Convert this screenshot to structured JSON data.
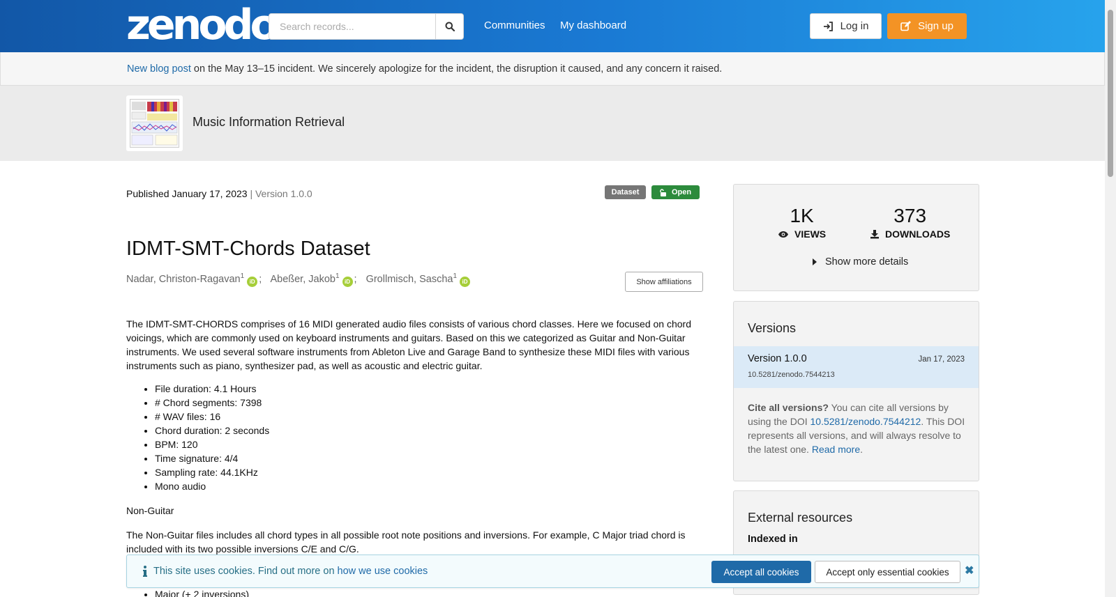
{
  "header": {
    "logo_text": "zenodo",
    "search_placeholder": "Search records...",
    "nav": [
      "Communities",
      "My dashboard"
    ],
    "login_label": "Log in",
    "signup_label": "Sign up"
  },
  "announcement": {
    "link_text": "New blog post",
    "text": " on the May 13–15 incident. We sincerely apologize for the incident, the disruption it caused, and any concern it raised."
  },
  "community": {
    "title": "Music Information Retrieval"
  },
  "record": {
    "published": "Published January 17, 2023",
    "version_text": " | Version 1.0.0",
    "labels": {
      "type": "Dataset",
      "access": "Open"
    },
    "title": "IDMT-SMT-Chords Dataset",
    "authors": [
      {
        "name": "Nadar, Christon-Ragavan",
        "sup": "1"
      },
      {
        "name": "Abeßer, Jakob",
        "sup": "1"
      },
      {
        "name": "Grollmisch, Sascha",
        "sup": "1"
      }
    ],
    "orcid_label": "iD",
    "show_affiliations_label": "Show affiliations",
    "description": "The IDMT-SMT-CHORDS comprises of 16 MIDI generated audio files consists of various chord classes. Here we focused on chord voicings, which are commonly used on keyboard instruments and guitars. Based on this we categorized as Guitar and Non-Guitar instruments. We used several software instruments from Ableton Live and Garage Band to synthesize these MIDI files with various instruments such as piano, synthesizer pad, as well as acoustic and electric guitar.",
    "facts": [
      "File duration: 4.1 Hours",
      "# Chord segments: 7398",
      "# WAV files: 16",
      "Chord duration: 2 seconds",
      "BPM: 120",
      "Time signature: 4/4",
      "Sampling rate: 44.1KHz",
      "Mono audio"
    ],
    "section_heading": "Non-Guitar",
    "section_text": "The Non-Guitar files includes all chord types in all possible root note positions and inversions. For example, C Major triad chord is included with its two possible inversions C/E and C/G.",
    "section_list": [
      "Major (+ 2 inversions)"
    ]
  },
  "stats": {
    "views": "1K",
    "views_label": "VIEWS",
    "downloads": "373",
    "downloads_label": "DOWNLOADS",
    "more_details_label": "Show more details"
  },
  "versions": {
    "heading": "Versions",
    "items": [
      {
        "name": "Version 1.0.0",
        "date": "Jan 17, 2023",
        "doi": "10.5281/zenodo.7544213"
      }
    ],
    "cite_bold": "Cite all versions?",
    "cite_text_1": " You can cite all versions by using the DOI ",
    "cite_doi": "10.5281/zenodo.7544212",
    "cite_text_2": ". This DOI represents all versions, and will always resolve to the latest one. ",
    "read_more": "Read more",
    "period": "."
  },
  "external_resources": {
    "heading": "External resources",
    "indexed_in": "Indexed in"
  },
  "cookie": {
    "message": "This site uses cookies. Find out more on ",
    "link": "how we use cookies",
    "accept_all": "Accept all cookies",
    "accept_essential": "Accept only essential cookies",
    "close_symbol": "✖"
  },
  "colors": {
    "header_start": "#1257a7",
    "header_end": "#27a3ec",
    "signup": "#f39325",
    "open_label": "#2c8b3c",
    "dataset_label": "#767676",
    "link": "#1f6aa8",
    "orcid": "#a6ce39"
  },
  "icons": [
    "search-icon",
    "login-icon",
    "edit-icon",
    "lock-open-icon",
    "orcid-icon",
    "eye-icon",
    "download-icon",
    "caret-right-icon",
    "info-icon",
    "close-icon"
  ]
}
